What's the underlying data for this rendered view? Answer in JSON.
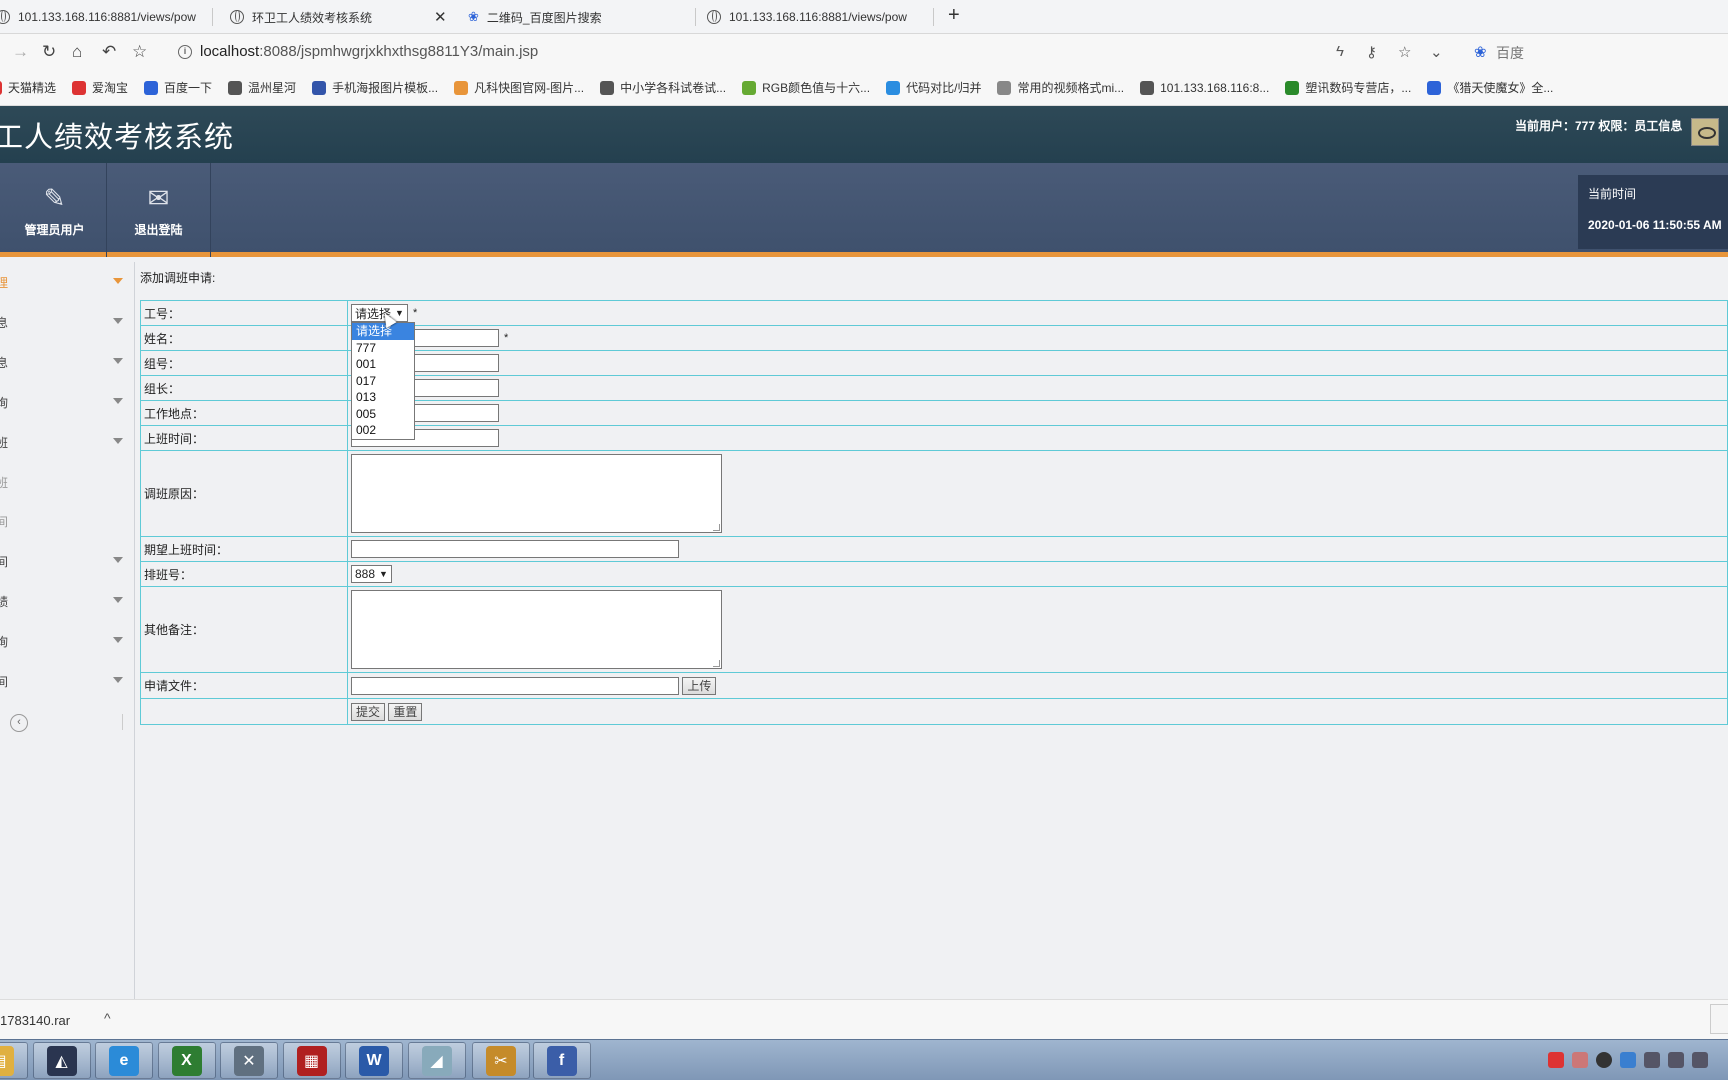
{
  "browser": {
    "tabs": [
      {
        "title": "101.133.168.116:8881/views/pow"
      },
      {
        "title": "环卫工人绩效考核系统"
      },
      {
        "title": "二维码_百度图片搜索"
      },
      {
        "title": "101.133.168.116:8881/views/pow"
      }
    ],
    "new_tab": "+",
    "close_tab": "✕",
    "url_host": "localhost",
    "url_rest": ":8088/jspmhwgrjxkhxthsg8811Y3/main.jsp",
    "search_engine": "百度",
    "bookmarks": [
      {
        "label": "天猫精选",
        "color": "#d33"
      },
      {
        "label": "爱淘宝",
        "color": "#d33"
      },
      {
        "label": "百度一下",
        "color": "#2d63d8"
      },
      {
        "label": "温州星河",
        "color": "#555"
      },
      {
        "label": "手机海报图片模板...",
        "color": "#3355aa"
      },
      {
        "label": "凡科快图官网-图片...",
        "color": "#e8953a"
      },
      {
        "label": "中小学各科试卷试...",
        "color": "#555"
      },
      {
        "label": "RGB颜色值与十六...",
        "color": "#6a3"
      },
      {
        "label": "代码对比/归并",
        "color": "#2a8de0"
      },
      {
        "label": "常用的视频格式mi...",
        "color": "#888"
      },
      {
        "label": "101.133.168.116:8...",
        "color": "#555"
      },
      {
        "label": "塑讯数码专营店，...",
        "color": "#2a8a2a"
      },
      {
        "label": "《猎天使魔女》全...",
        "color": "#2d63d8"
      }
    ]
  },
  "app": {
    "title": "工人绩效考核系统",
    "user_info": "当前用户：777  权限：员工信息",
    "toolbar": [
      {
        "label": "管理员用户",
        "icon": "pencil-icon"
      },
      {
        "label": "退出登陆",
        "icon": "envelope-icon"
      }
    ],
    "time_label": "当前时间",
    "time_value": "2020-01-06 11:50:55 AM"
  },
  "sidebar": {
    "items": [
      {
        "label": "理",
        "state": "active",
        "caret": true
      },
      {
        "label": "息",
        "state": "normal",
        "caret": true
      },
      {
        "label": "息",
        "state": "normal",
        "caret": true
      },
      {
        "label": "询",
        "state": "normal",
        "caret": true
      },
      {
        "label": "班",
        "state": "normal",
        "caret": true
      },
      {
        "label": "班",
        "state": "muted",
        "caret": false
      },
      {
        "label": "间",
        "state": "muted",
        "caret": false
      },
      {
        "label": "间",
        "state": "normal",
        "caret": true
      },
      {
        "label": "绩",
        "state": "normal",
        "caret": true
      },
      {
        "label": "询",
        "state": "normal",
        "caret": true
      },
      {
        "label": "间",
        "state": "normal",
        "caret": true
      }
    ],
    "collapse_icon": "‹"
  },
  "form": {
    "title": "添加调班申请:",
    "labels": {
      "emp_no": "工号：",
      "name": "姓名：",
      "group_no": "组号：",
      "group_leader": "组长：",
      "work_place": "工作地点：",
      "work_time": "上班时间：",
      "reason": "调班原因：",
      "expected_time": "期望上班时间：",
      "shift_no": "排班号：",
      "remarks": "其他备注：",
      "file": "申请文件："
    },
    "emp_no_selected": "请选择",
    "required_mark": "*",
    "shift_no_selected": "888",
    "upload_button": "上传",
    "submit_button": "提交",
    "reset_button": "重置",
    "emp_no_options": [
      "请选择",
      "777",
      "001",
      "017",
      "013",
      "005",
      "002"
    ]
  },
  "download": {
    "file_name": "1783140.rar",
    "chevron": "^"
  },
  "taskbar": {
    "apps": [
      {
        "icon": "file-explorer-icon",
        "color": "#e0b040"
      },
      {
        "icon": "eclipse-icon",
        "color": "#2a3550"
      },
      {
        "icon": "ie-icon",
        "color": "#2b8bd8"
      },
      {
        "icon": "excel-icon",
        "color": "#2e7d32"
      },
      {
        "icon": "tools-icon",
        "color": "#607080"
      },
      {
        "icon": "media-icon",
        "color": "#b02020"
      },
      {
        "icon": "word-icon",
        "color": "#2a5aa8"
      },
      {
        "icon": "eraser-icon",
        "color": "#8ab"
      },
      {
        "icon": "snipping-icon",
        "color": "#c58b2a"
      },
      {
        "icon": "fedora-icon",
        "color": "#3b5ea8"
      }
    ]
  }
}
